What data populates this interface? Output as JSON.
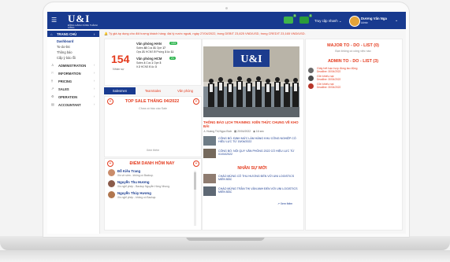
{
  "header": {
    "logo_text": "U&I",
    "logo_sub": "ĐỒNG HÀNH CÙNG THÀNH CÔNG",
    "badge_1": "5",
    "badge_2": "0",
    "quick_access": "Truy cập nhanh",
    "user_name": "Dương Văn Nga",
    "user_role": "Admin"
  },
  "sidebar": {
    "active": "TRANG CHỦ",
    "subitems": [
      "Dashboard",
      "To-do-list",
      "Thông báo",
      "Cấp ý bảo lỗi"
    ],
    "items": [
      {
        "label": "ADMINISTRATION",
        "icon": "user-icon"
      },
      {
        "label": "INFORMATION",
        "icon": "flag-icon"
      },
      {
        "label": "PRICING",
        "icon": "tag-icon"
      },
      {
        "label": "SALES",
        "icon": "chart-icon"
      },
      {
        "label": "OPERATION",
        "icon": "gear-icon"
      },
      {
        "label": "ACCOUNTANT",
        "icon": "calculator-icon"
      }
    ]
  },
  "notice": "Tỷ giá áp dụng cho đối tượng khách hàng: đại lý nước ngoài, ngày 27/04/2022, trong DEBIT 23,825 VND/USD, trong CREDIT 23,165 VND/USD.",
  "summary": {
    "total": "154",
    "total_label": "Nhân sự",
    "han": {
      "title": "Văn phòng HAN",
      "count": "133",
      "row1": [
        "Sales",
        "48",
        "Cus",
        "31",
        "Ope",
        "17"
      ],
      "row2": [
        "Ops",
        "21",
        "HCNS",
        "5",
        "Phòng",
        "3",
        "Ac",
        "11"
      ]
    },
    "hcm": {
      "title": "Văn phòng HCM",
      "count": "21",
      "row1": [
        "Sales",
        "4",
        "Cus",
        "1",
        "Ope",
        "3"
      ],
      "row2": [
        "It",
        "2",
        "HCNS",
        "0",
        "Ac",
        "3"
      ]
    }
  },
  "tabs": [
    "Salesmen",
    "TeamSales",
    "Văn phòng"
  ],
  "top_sale": {
    "title": "TOP SALE THÁNG 04/2022",
    "empty": "Chưa có báo cáo Sale",
    "more": "Xem thêm"
  },
  "attendance": {
    "title": "ĐIỂM DANH HÔM NAY",
    "people": [
      {
        "name": "Đỗ Kiều Trang",
        "note": "Xin về sớm - không có Backup."
      },
      {
        "name": "Nguyễn Thu Hương",
        "note": "Xin nghỉ phép - Backup Nguyễn Hồng Nhung."
      },
      {
        "name": "Nguyễn Thủy Hương",
        "note": "Xin nghỉ phép - không có Backup."
      }
    ]
  },
  "news": {
    "title": "THÔNG BÁO LỊCH TRAINING: KIẾN THỨC CHUNG VỀ KHO BÃI",
    "author": "Hoàng Thị Ngọc Bích",
    "date": "20/04/2022",
    "time": "16 sec",
    "items": [
      "CÔNG BỐ: ĐỊNH MỨC LÀM HÀNG KHU CÔNG NGHIỆP CÓ HIỆU LỰC TỪ 15/04/2022",
      "CÔNG BỐ: NỘI QUY VĂN PHÒNG 2022 CÓ HIỆU LỰC TỪ 01/04/2022"
    ]
  },
  "new_staff": {
    "title": "NHÂN SỰ MỚI",
    "items": [
      "CHÀO MỪNG CÔ THU HƯƠNG ĐẾN VỚI UNI LOGISTICS MIỀN BẮC",
      "CHÀO MỪNG TRẦN THỊ VÂN ANH ĐẾN VỚI UNI LOGISTICS MIỀN BẮC"
    ],
    "more": "Xem thêm"
  },
  "major_todo": {
    "title": "MAJOR TO - DO - LIST (0)",
    "sub": "Bạn không có công việc nào"
  },
  "admin_todo": {
    "title": "ADMIN TO - DO - LIST (3)",
    "items": [
      {
        "title": "Giấy hết hạn hợp đồng lao động",
        "date": "Deadline: 30/04/2022"
      },
      {
        "title": "Gửi khiếu nại",
        "date": "Deadline: 30/04/2022"
      },
      {
        "title": "Gửi khiếu nại",
        "date": "Deadline: 30/04/2022"
      }
    ]
  },
  "colors": {
    "brand": "#183a8f",
    "accent": "#e43b1e",
    "green": "#2fb650"
  }
}
